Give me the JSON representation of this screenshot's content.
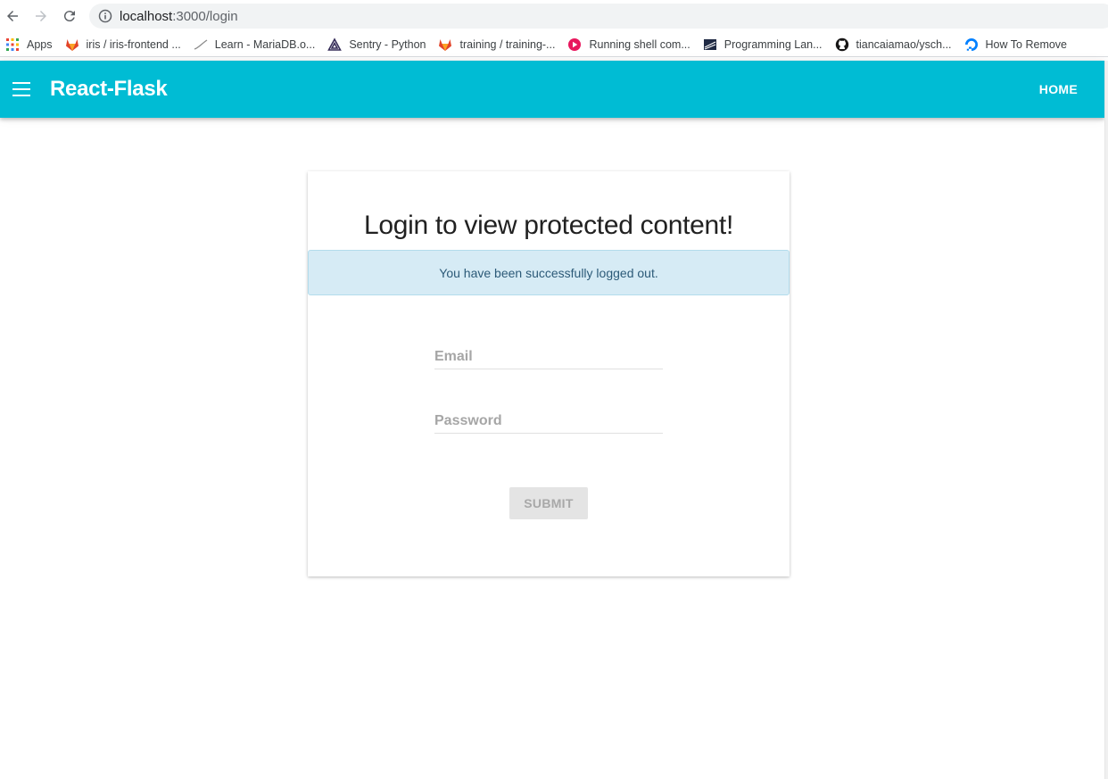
{
  "browser": {
    "url_host": "localhost",
    "url_path": ":3000/login",
    "bookmarks": [
      {
        "label": "Apps",
        "icon": "apps-grid-icon"
      },
      {
        "label": "iris / iris-frontend ...",
        "icon": "gitlab-icon"
      },
      {
        "label": "Learn - MariaDB.o...",
        "icon": "mariadb-icon"
      },
      {
        "label": "Sentry - Python",
        "icon": "sentry-icon"
      },
      {
        "label": "training / training-...",
        "icon": "gitlab-icon"
      },
      {
        "label": "Running shell com...",
        "icon": "play-icon"
      },
      {
        "label": "Programming Lan...",
        "icon": "stack-icon"
      },
      {
        "label": "tiancaiamao/ysch...",
        "icon": "github-icon"
      },
      {
        "label": "How To Remove",
        "icon": "digitalocean-icon"
      }
    ]
  },
  "app_bar": {
    "title": "React-Flask",
    "home_label": "HOME",
    "color": "#00bcd4"
  },
  "login_card": {
    "title": "Login to view protected content!",
    "alert_message": "You have been successfully logged out.",
    "email_placeholder": "Email",
    "password_placeholder": "Password",
    "submit_label": "SUBMIT"
  }
}
